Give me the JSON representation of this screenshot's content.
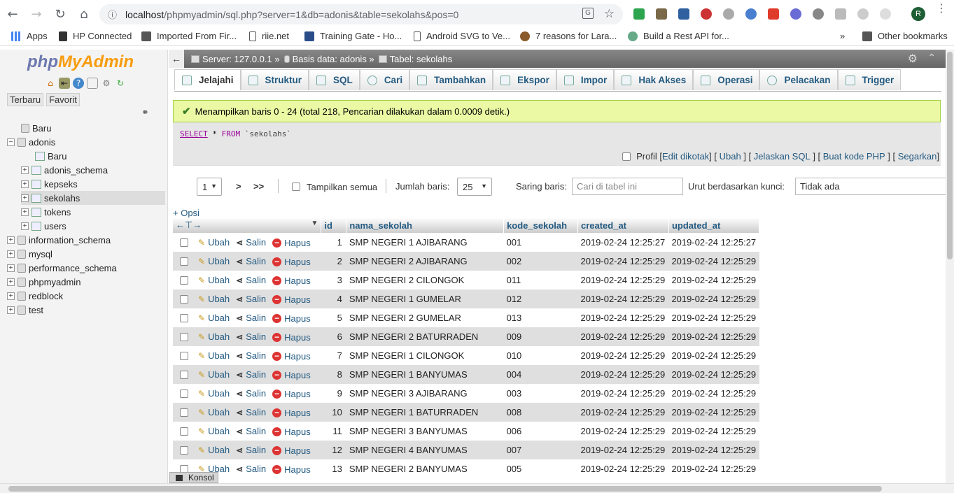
{
  "browser": {
    "url_host": "localhost",
    "url_path": "/phpmyadmin/sql.php?server=1&db=adonis&table=sekolahs&pos=0",
    "avatar_letter": "R",
    "bookmarks": [
      "Apps",
      "HP Connected",
      "Imported From Fir...",
      "riie.net",
      "Training Gate - Ho...",
      "Android SVG to Ve...",
      "7 reasons for Lara...",
      "Build a Rest API for..."
    ],
    "more_bookmarks": "»",
    "other_bookmarks": "Other bookmarks"
  },
  "sidebar": {
    "logo_part1": "php",
    "logo_part2": "MyAdmin",
    "tab_recent": "Terbaru",
    "tab_favorite": "Favorit",
    "tree": [
      {
        "label": "Baru"
      },
      {
        "label": "adonis"
      },
      {
        "label": "Baru"
      },
      {
        "label": "adonis_schema"
      },
      {
        "label": "kepseks"
      },
      {
        "label": "sekolahs"
      },
      {
        "label": "tokens"
      },
      {
        "label": "users"
      },
      {
        "label": "information_schema"
      },
      {
        "label": "mysql"
      },
      {
        "label": "performance_schema"
      },
      {
        "label": "phpmyadmin"
      },
      {
        "label": "redblock"
      },
      {
        "label": "test"
      }
    ]
  },
  "breadcrumb": {
    "server": "Server: 127.0.0.1",
    "database": "Basis data: adonis",
    "table": "Tabel: sekolahs"
  },
  "tabs": [
    "Jelajahi",
    "Struktur",
    "SQL",
    "Cari",
    "Tambahkan",
    "Ekspor",
    "Impor",
    "Hak Akses",
    "Operasi",
    "Pelacakan",
    "Trigger"
  ],
  "message": "Menampilkan baris 0 - 24 (total 218, Pencarian dilakukan dalam 0.0009 detik.)",
  "sql": {
    "select": "SELECT",
    "star": " * ",
    "from": "FROM",
    "table": " `sekolahs`"
  },
  "sql_tools": {
    "profil": "Profil",
    "edit_inline": "Edit dikotak",
    "edit": "Ubah",
    "explain": "Jelaskan SQL",
    "create_php": "Buat kode PHP",
    "refresh": "Segarkan"
  },
  "nav": {
    "page": "1",
    "next": ">",
    "last": ">>",
    "show_all": "Tampilkan semua",
    "rows_label": "Jumlah baris:",
    "rows_value": "25",
    "filter_label": "Saring baris:",
    "filter_placeholder": "Cari di tabel ini",
    "sort_label": "Urut berdasarkan kunci:",
    "sort_value": "Tidak ada"
  },
  "options_link": "+ Opsi",
  "table": {
    "columns": [
      "id",
      "nama_sekolah",
      "kode_sekolah",
      "created_at",
      "updated_at"
    ],
    "action_edit": "Ubah",
    "action_copy": "Salin",
    "action_delete": "Hapus",
    "rows": [
      [
        "1",
        "SMP NEGERI 1 AJIBARANG",
        "001",
        "2019-02-24 12:25:27",
        "2019-02-24 12:25:27"
      ],
      [
        "2",
        "SMP NEGERI 2 AJIBARANG",
        "002",
        "2019-02-24 12:25:29",
        "2019-02-24 12:25:29"
      ],
      [
        "3",
        "SMP NEGERI 2 CILONGOK",
        "011",
        "2019-02-24 12:25:29",
        "2019-02-24 12:25:29"
      ],
      [
        "4",
        "SMP NEGERI 1 GUMELAR",
        "012",
        "2019-02-24 12:25:29",
        "2019-02-24 12:25:29"
      ],
      [
        "5",
        "SMP NEGERI 2 GUMELAR",
        "013",
        "2019-02-24 12:25:29",
        "2019-02-24 12:25:29"
      ],
      [
        "6",
        "SMP NEGERI 2 BATURRADEN",
        "009",
        "2019-02-24 12:25:29",
        "2019-02-24 12:25:29"
      ],
      [
        "7",
        "SMP NEGERI 1 CILONGOK",
        "010",
        "2019-02-24 12:25:29",
        "2019-02-24 12:25:29"
      ],
      [
        "8",
        "SMP NEGERI 1 BANYUMAS",
        "004",
        "2019-02-24 12:25:29",
        "2019-02-24 12:25:29"
      ],
      [
        "9",
        "SMP NEGERI 3 AJIBARANG",
        "003",
        "2019-02-24 12:25:29",
        "2019-02-24 12:25:29"
      ],
      [
        "10",
        "SMP NEGERI 1 BATURRADEN",
        "008",
        "2019-02-24 12:25:29",
        "2019-02-24 12:25:29"
      ],
      [
        "11",
        "SMP NEGERI 3 BANYUMAS",
        "006",
        "2019-02-24 12:25:29",
        "2019-02-24 12:25:29"
      ],
      [
        "12",
        "SMP NEGERI 4 BANYUMAS",
        "007",
        "2019-02-24 12:25:29",
        "2019-02-24 12:25:29"
      ],
      [
        "13",
        "SMP NEGERI 2 BANYUMAS",
        "005",
        "2019-02-24 12:25:29",
        "2019-02-24 12:25:29"
      ]
    ]
  },
  "console_label": "Konsol",
  "colors": {
    "link": "#235a81",
    "success_bg": "#ebf8a4",
    "topbar": "#777777"
  }
}
